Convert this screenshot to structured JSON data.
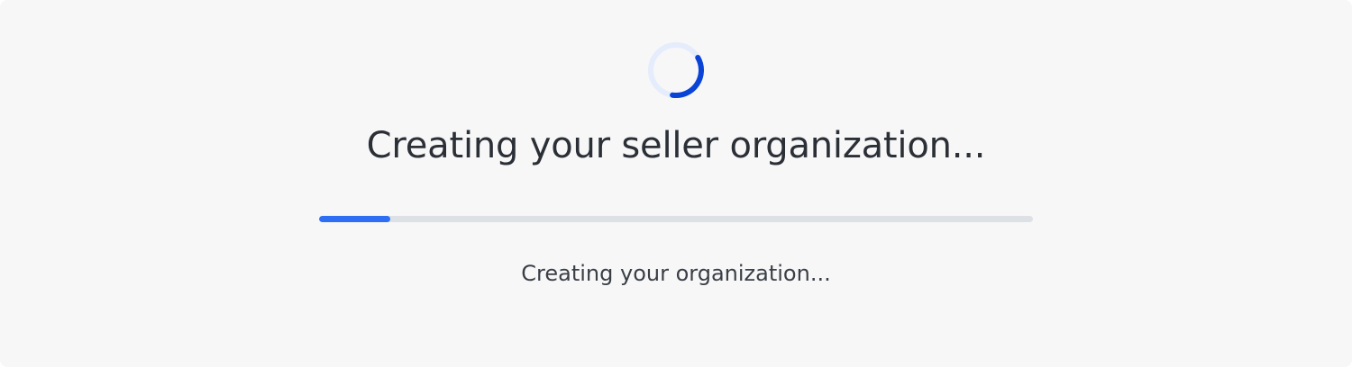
{
  "loader": {
    "spinner_icon": "loading-spinner-icon",
    "title": "Creating your seller organization...",
    "progress_fraction": 0.1,
    "status_text": "Creating your organization...",
    "colors": {
      "accent": "#2d6ef5",
      "spinner_arc": "#0a44d6",
      "spinner_track": "#e5ecfb",
      "track": "#dde1e6",
      "text": "#2b2f36",
      "background": "#f7f7f8"
    }
  }
}
